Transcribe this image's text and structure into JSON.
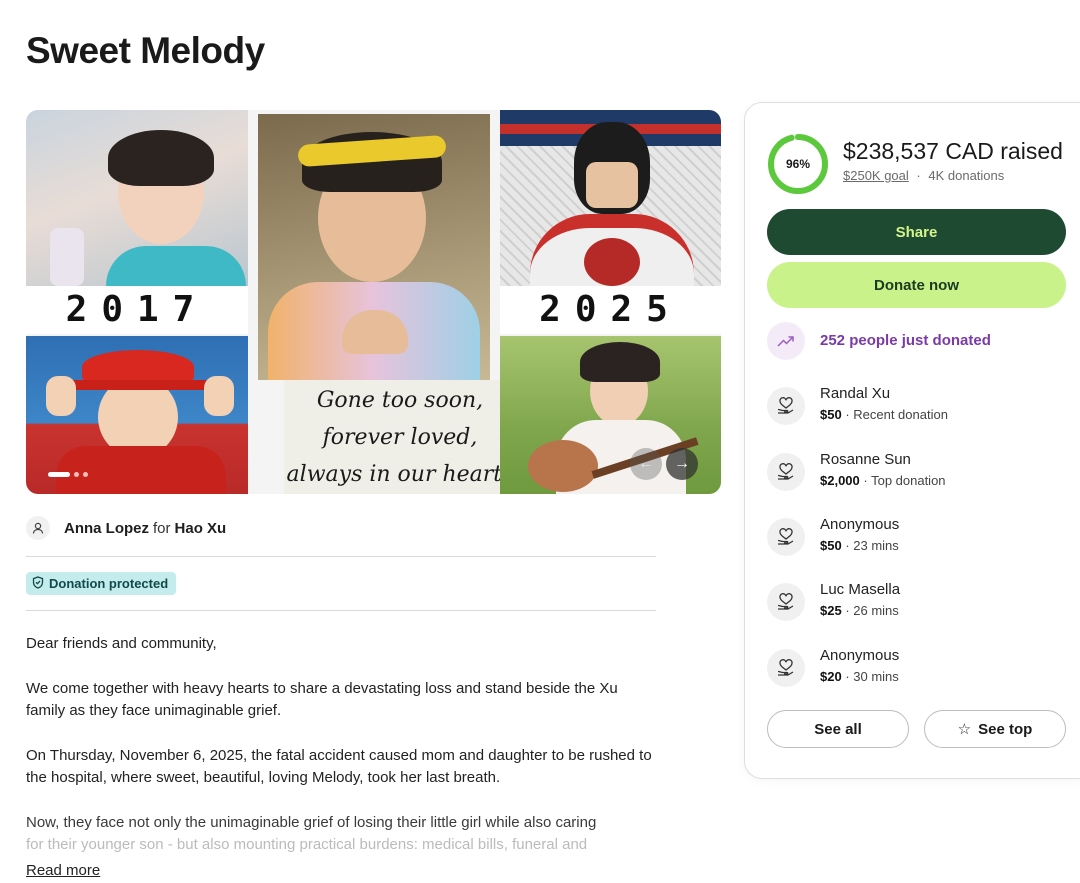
{
  "page": {
    "title": "Sweet Melody"
  },
  "gallery": {
    "year_left": "2017",
    "year_right": "2025",
    "caption_lines": [
      "Gone too soon,",
      "forever loved,",
      "always in our hearts"
    ],
    "slide_count": 3,
    "active_slide": 1,
    "prev_icon": "arrow-left-icon",
    "next_icon": "arrow-right-icon"
  },
  "organizer": {
    "name": "Anna Lopez",
    "for_word": "for",
    "beneficiary": "Hao Xu"
  },
  "badge": {
    "label": "Donation protected",
    "icon": "shield-icon"
  },
  "story": {
    "paragraphs": [
      "Dear friends and community,",
      "We come together with heavy hearts to share a devastating loss and stand beside the Xu family as they face unimaginable grief.",
      "On Thursday, November 6, 2025, the fatal accident caused mom and daughter to be rushed to the hospital, where sweet, beautiful, loving Melody, took her last breath."
    ],
    "faded_line_1": "Now, they face not only the unimaginable grief of losing their little girl while also caring",
    "faded_line_2": "for their younger son - but also mounting practical burdens: medical bills, funeral and",
    "read_more": "Read more"
  },
  "fundraiser": {
    "percent": 96,
    "percent_label": "96%",
    "raised": "$238,537 CAD raised",
    "goal": "$250K goal",
    "separator": "·",
    "donations": "4K donations",
    "share_label": "Share",
    "donate_label": "Donate now",
    "trend_text": "252 people just donated",
    "see_all_label": "See all",
    "see_top_label": "See top",
    "accent_dark": "#1e4a32",
    "accent_light": "#c9f38a",
    "ring_color": "#5cc83c",
    "trend_color": "#7b3aa8"
  },
  "donors": [
    {
      "name": "Randal Xu",
      "amount": "$50",
      "detail": " · Recent donation"
    },
    {
      "name": "Rosanne Sun",
      "amount": "$2,000",
      "detail": " · Top donation"
    },
    {
      "name": "Anonymous",
      "amount": "$50",
      "detail": " · 23 mins"
    },
    {
      "name": "Luc Masella",
      "amount": "$25",
      "detail": " · 26 mins"
    },
    {
      "name": "Anonymous",
      "amount": "$20",
      "detail": " · 30 mins"
    }
  ]
}
